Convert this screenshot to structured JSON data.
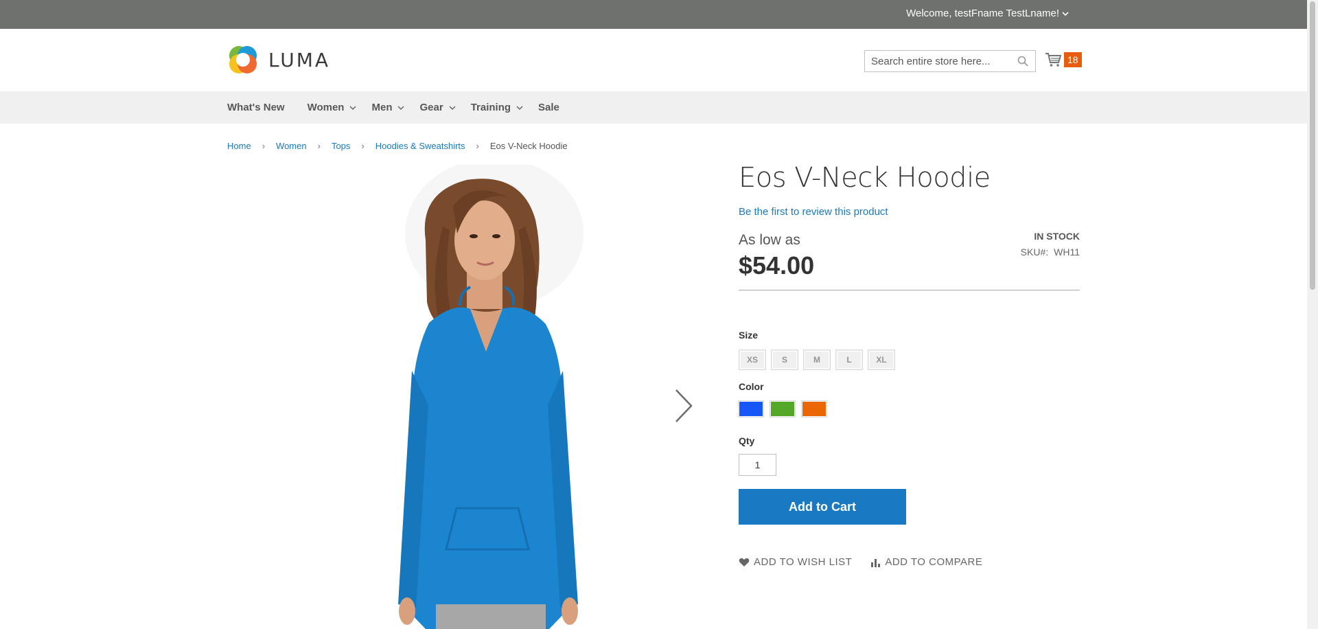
{
  "header": {
    "welcome_text": "Welcome, testFname TestLname!",
    "logo_text": "LUMA",
    "search_placeholder": "Search entire store here...",
    "cart_count": "18"
  },
  "nav": {
    "items": [
      {
        "label": "What's New",
        "dropdown": false
      },
      {
        "label": "Women",
        "dropdown": true
      },
      {
        "label": "Men",
        "dropdown": true
      },
      {
        "label": "Gear",
        "dropdown": true
      },
      {
        "label": "Training",
        "dropdown": true
      },
      {
        "label": "Sale",
        "dropdown": false
      }
    ]
  },
  "breadcrumb": {
    "items": [
      "Home",
      "Women",
      "Tops",
      "Hoodies & Sweatshirts"
    ],
    "current": "Eos V-Neck Hoodie"
  },
  "product": {
    "title": "Eos V-Neck Hoodie",
    "review_link": "Be the first to review this product",
    "price_prefix": "As low as",
    "price": "$54.00",
    "stock": "IN STOCK",
    "sku_label": "SKU#:",
    "sku_value": "WH11",
    "size_label": "Size",
    "sizes": [
      "XS",
      "S",
      "M",
      "L",
      "XL"
    ],
    "color_label": "Color",
    "colors": [
      "#1857f7",
      "#53a828",
      "#eb6703"
    ],
    "qty_label": "Qty",
    "qty_value": "1",
    "add_to_cart": "Add to Cart",
    "wishlist": "ADD TO WISH LIST",
    "compare": "ADD TO COMPARE"
  },
  "icons": {
    "search": "search-icon",
    "cart": "cart-icon",
    "next": "chevron-right-icon",
    "heart": "heart-icon",
    "compare": "bar-chart-icon"
  }
}
